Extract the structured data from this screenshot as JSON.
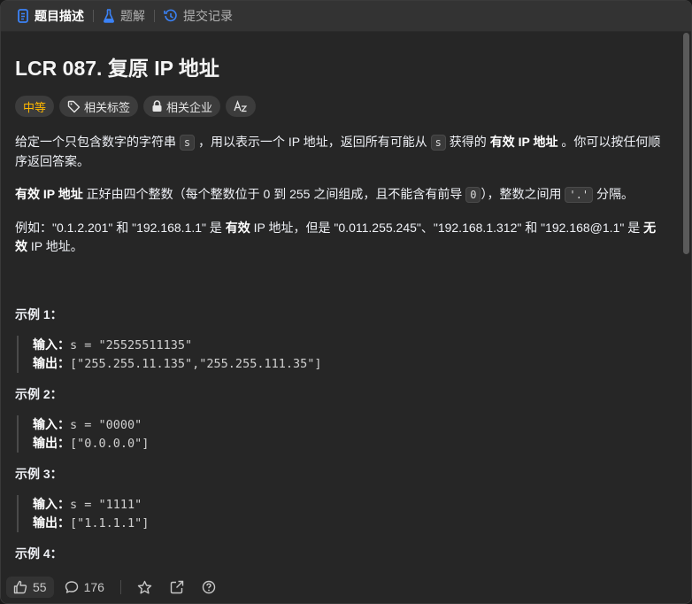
{
  "tabs": [
    {
      "label": "题目描述",
      "icon": "document-icon",
      "active": true
    },
    {
      "label": "题解",
      "icon": "flask-icon",
      "active": false
    },
    {
      "label": "提交记录",
      "icon": "history-icon",
      "active": false
    }
  ],
  "problem": {
    "title": "LCR 087. 复原 IP 地址",
    "difficulty": "中等",
    "tags": [
      "相关标签",
      "相关企业"
    ],
    "para1": {
      "t1": "给定一个只包含数字的字符串 ",
      "code1": "s",
      "t2": " ，用以表示一个 IP 地址，返回所有可能从 ",
      "code2": "s",
      "t3": " 获得的 ",
      "bold": "有效 IP 地址",
      "t4": " 。你可以按任何顺序返回答案。"
    },
    "para2": {
      "bold": "有效 IP 地址",
      "t1": " 正好由四个整数（每个整数位于 0 到 255 之间组成，且不能含有前导 ",
      "code1": "0",
      "t2": "），整数之间用 ",
      "code2": "'.'",
      "t3": " 分隔。"
    },
    "para3": {
      "t1": "例如：\"0.1.2.201\" 和 \"192.168.1.1\" 是 ",
      "bold1": "有效",
      "t2": " IP 地址，但是 \"0.011.255.245\"、\"192.168.1.312\" 和 \"192.168@1.1\" 是 ",
      "bold2": "无效",
      "t3": " IP 地址。"
    },
    "examples": [
      {
        "title": "示例 1：",
        "input_label": "输入：",
        "input": "s = \"25525511135\"",
        "output_label": "输出：",
        "output": "[\"255.255.11.135\",\"255.255.111.35\"]"
      },
      {
        "title": "示例 2：",
        "input_label": "输入：",
        "input": "s = \"0000\"",
        "output_label": "输出：",
        "output": "[\"0.0.0.0\"]"
      },
      {
        "title": "示例 3：",
        "input_label": "输入：",
        "input": "s = \"1111\"",
        "output_label": "输出：",
        "output": "[\"1.1.1.1\"]"
      },
      {
        "title": "示例 4："
      }
    ]
  },
  "bottom": {
    "likes": "55",
    "comments": "176"
  },
  "colors": {
    "difficulty_medium": "#ffb800",
    "background": "#262626",
    "tabbar": "#333333"
  }
}
